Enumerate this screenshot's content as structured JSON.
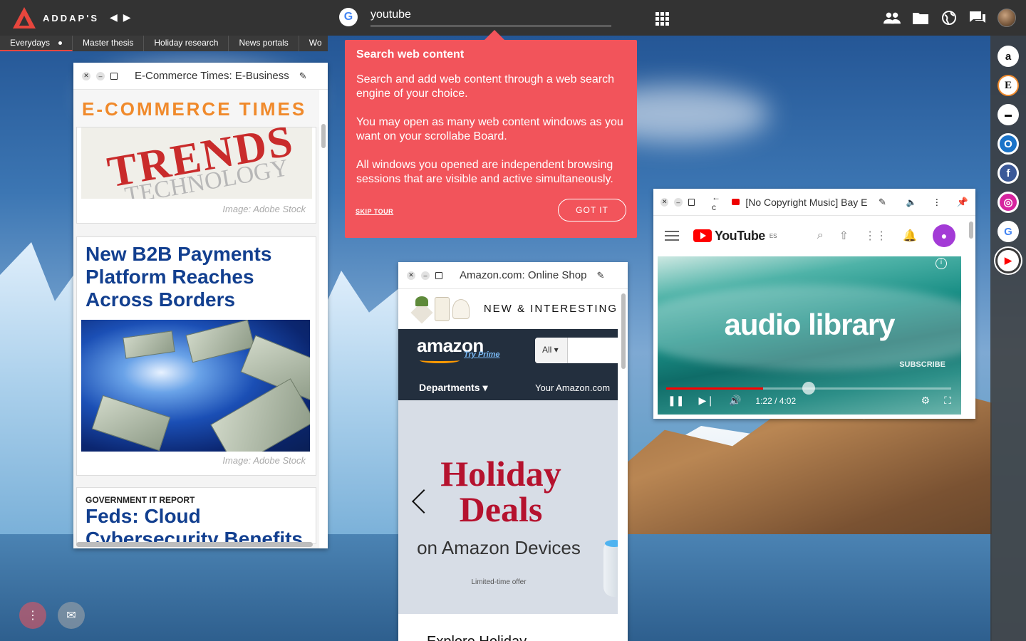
{
  "app": {
    "logo_text": "ADDAP'S",
    "search": {
      "value": "youtube",
      "engine": "G"
    }
  },
  "tabs": [
    {
      "label": "Everydays",
      "active": true
    },
    {
      "label": "Master thesis"
    },
    {
      "label": "Holiday research"
    },
    {
      "label": "News portals"
    },
    {
      "label": "Wo"
    }
  ],
  "tour": {
    "title": "Search web content",
    "p1": "Search and add web content through a web search engine of your choice.",
    "p2": "You may open as many web content windows as you want on your scrollabe Board.",
    "p3": "All windows you opened are independent browsing sessions that are visible and active simultaneously.",
    "skip": "SKIP TOUR",
    "got_it": "GOT IT"
  },
  "ecommerce": {
    "title": "E-Commerce Times: E-Business",
    "brand": "E-COMMERCE TIMES",
    "trends_word": "TRENDS",
    "trends_sub": "TECHNOLOGY",
    "caption1": "Image: Adobe Stock",
    "headline": "New B2B Payments Platform Reaches Across Borders",
    "caption2": "Image: Adobe Stock",
    "kicker": "GOVERNMENT IT REPORT",
    "headline2": "Feds: Cloud Cybersecurity Benefits"
  },
  "amazon": {
    "title": "Amazon.com: Online Shop",
    "promo": "NEW & INTERESTING",
    "logo": "amazon",
    "prime": "Try Prime",
    "all": "All",
    "departments": "Departments",
    "your_amazon": "Your Amazon.com",
    "hero_line1": "Holiday",
    "hero_line2": "Deals",
    "hero_sub": "on Amazon Devices",
    "limited": "Limited-time offer",
    "explore": "Explore Holiday"
  },
  "youtube": {
    "title": "[No Copyright Music] Bay E",
    "brand": "YouTube",
    "region": "ES",
    "video_text": "audio library",
    "subscribe": "SUBSCRIBE",
    "time": "1:22 / 4:02",
    "progress": 0.34
  },
  "rail": [
    {
      "name": "amazon",
      "glyph": "a"
    },
    {
      "name": "ecommerce",
      "glyph": "E"
    },
    {
      "name": "news",
      "glyph": "▬"
    },
    {
      "name": "outlook",
      "glyph": "O"
    },
    {
      "name": "facebook",
      "glyph": "f"
    },
    {
      "name": "instagram",
      "glyph": "◎"
    },
    {
      "name": "google",
      "glyph": "G"
    },
    {
      "name": "youtube",
      "glyph": "▶"
    }
  ],
  "colors": {
    "accent": "#f2545b",
    "topbar": "#333333",
    "amazon_nav": "#232f3e",
    "youtube_red": "#ff0000",
    "headline_blue": "#123f8f"
  }
}
